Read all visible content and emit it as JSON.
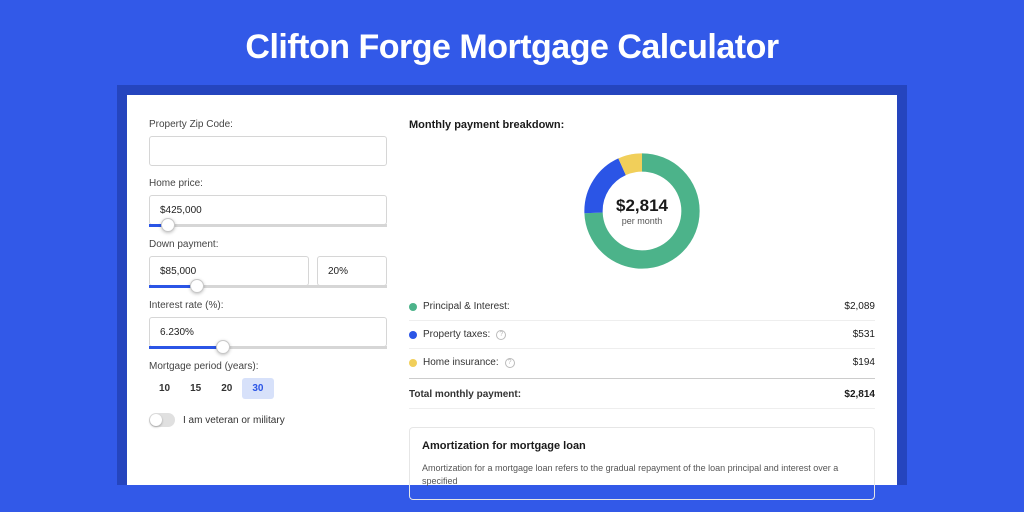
{
  "title": "Clifton Forge Mortgage Calculator",
  "left": {
    "zip": {
      "label": "Property Zip Code:",
      "value": ""
    },
    "price": {
      "label": "Home price:",
      "value": "$425,000",
      "slider_pct": 8
    },
    "down": {
      "label": "Down payment:",
      "value": "$85,000",
      "pct": "20%",
      "slider_pct": 20
    },
    "rate": {
      "label": "Interest rate (%):",
      "value": "6.230%",
      "slider_pct": 31
    },
    "period": {
      "label": "Mortgage period (years):",
      "options": [
        "10",
        "15",
        "20",
        "30"
      ],
      "selected": "30"
    },
    "veteran": {
      "label": "I am veteran or military",
      "on": false
    }
  },
  "breakdown": {
    "heading": "Monthly payment breakdown:",
    "total": "$2,814",
    "per_month": "per month",
    "items": [
      {
        "label": "Principal & Interest:",
        "value": "$2,089",
        "color": "#4cb38a",
        "help": false
      },
      {
        "label": "Property taxes:",
        "value": "$531",
        "color": "#2b55e6",
        "help": true
      },
      {
        "label": "Home insurance:",
        "value": "$194",
        "color": "#f1cf5a",
        "help": true
      }
    ],
    "total_label": "Total monthly payment:"
  },
  "chart_data": {
    "type": "pie",
    "title": "",
    "series": [
      {
        "name": "Principal & Interest",
        "value": 2089,
        "color": "#4cb38a"
      },
      {
        "name": "Property taxes",
        "value": 531,
        "color": "#2b55e6"
      },
      {
        "name": "Home insurance",
        "value": 194,
        "color": "#f1cf5a"
      }
    ],
    "total": 2814,
    "center_label": "$2,814",
    "center_sub": "per month"
  },
  "amort": {
    "heading": "Amortization for mortgage loan",
    "text": "Amortization for a mortgage loan refers to the gradual repayment of the loan principal and interest over a specified"
  }
}
